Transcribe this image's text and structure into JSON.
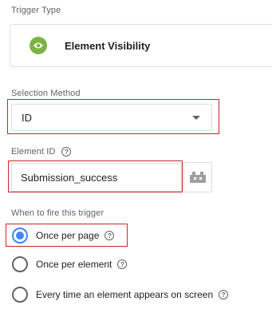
{
  "trigger_type": {
    "label": "Trigger Type",
    "selected": "Element Visibility",
    "icon": "eye-icon",
    "icon_color": "#7cb342"
  },
  "selection_method": {
    "label": "Selection Method",
    "value": "ID"
  },
  "element_id": {
    "label": "Element ID",
    "value": "Submission_success",
    "variable_button_icon": "building-blocks-icon"
  },
  "fire_when": {
    "label": "When to fire this trigger",
    "options": [
      {
        "label": "Once per page",
        "selected": true
      },
      {
        "label": "Once per element",
        "selected": false
      },
      {
        "label": "Every time an element appears on screen",
        "selected": false
      }
    ]
  },
  "colors": {
    "highlight_border": "#c62828",
    "radio_selected": "#4285f4"
  }
}
